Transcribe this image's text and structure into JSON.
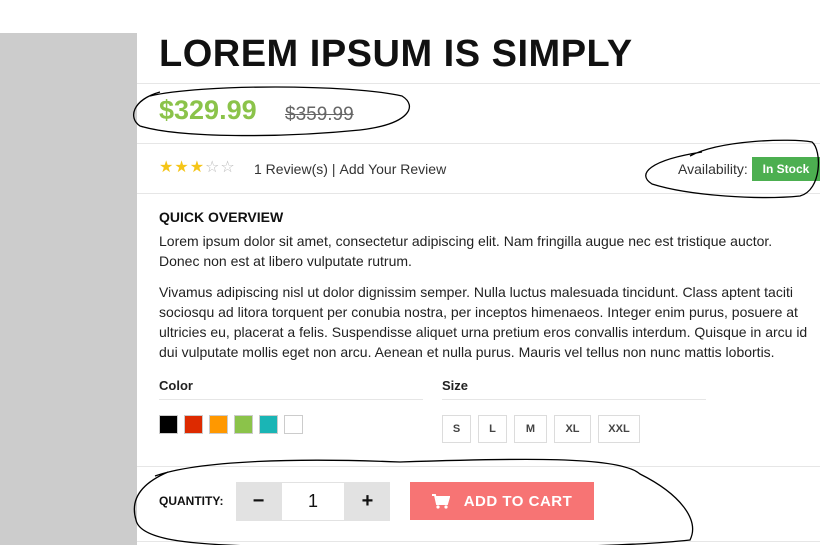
{
  "product": {
    "title": "LOREM IPSUM IS SIMPLY",
    "price": "$329.99",
    "old_price": "$359.99",
    "rating": {
      "filled": 3,
      "total": 5
    },
    "reviews_label": "1 Review(s)",
    "separator": "|",
    "add_review_label": "Add Your Review",
    "availability_label": "Availability:",
    "stock_status": "In Stock"
  },
  "overview": {
    "title": "QUICK OVERVIEW",
    "paragraph1": "Lorem ipsum dolor sit amet, consectetur adipiscing elit. Nam fringilla augue nec est tristique auctor. Donec non est at libero vulputate rutrum.",
    "paragraph2": "Vivamus adipiscing nisl ut dolor dignissim semper. Nulla luctus malesuada tincidunt. Class aptent taciti sociosqu ad litora torquent per conubia nostra, per inceptos himenaeos. Integer enim purus, posuere at ultricies eu, placerat a felis. Suspendisse aliquet urna pretium eros convallis interdum. Quisque in arcu id dui vulputate mollis eget non arcu. Aenean et nulla purus. Mauris vel tellus non nunc mattis lobortis."
  },
  "options": {
    "color_label": "Color",
    "colors": [
      "#000000",
      "#dd2a00",
      "#ff9800",
      "#8bc34a",
      "#1ab5b5",
      "#ffffff"
    ],
    "size_label": "Size",
    "sizes": [
      "S",
      "L",
      "M",
      "XL",
      "XXL"
    ]
  },
  "cart": {
    "quantity_label": "QUANTITY:",
    "minus": "−",
    "quantity": "1",
    "plus": "+",
    "add_to_cart_label": "ADD TO CART",
    "cart_icon": "cart-icon"
  },
  "colors": {
    "price": "#8bc34a",
    "stock_badge": "#4caf50",
    "add_to_cart": "#f77474",
    "star": "#f5c518"
  }
}
